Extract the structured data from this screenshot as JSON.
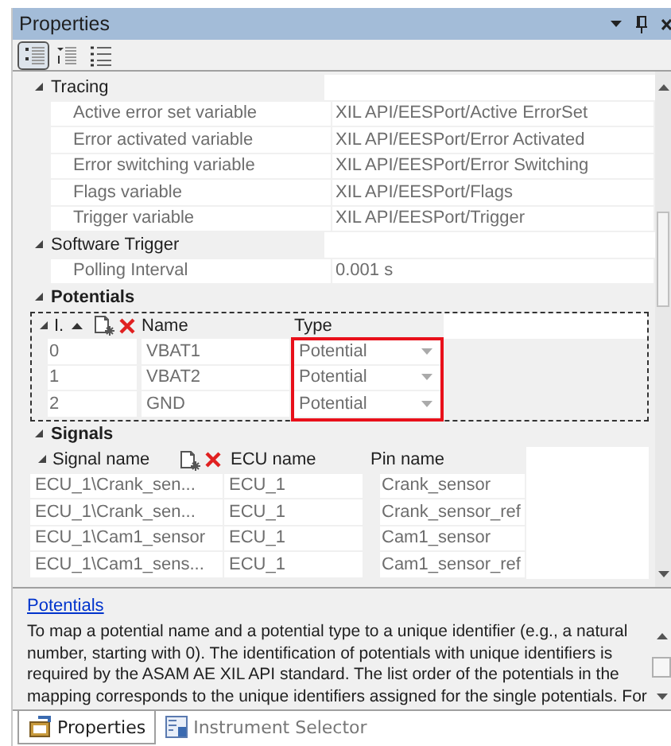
{
  "window": {
    "title": "Properties"
  },
  "toolbar": [
    {
      "kind": "categorized",
      "selected": true
    },
    {
      "kind": "alphabetical",
      "selected": false
    },
    {
      "kind": "pages",
      "selected": false
    }
  ],
  "categories": [
    {
      "name": "Tracing",
      "expanded": true,
      "properties": [
        {
          "name": "Active error set variable",
          "value": "XIL API/EESPort/Active ErrorSet"
        },
        {
          "name": "Error activated variable",
          "value": "XIL API/EESPort/Error Activated"
        },
        {
          "name": "Error switching variable",
          "value": "XIL API/EESPort/Error Switching"
        },
        {
          "name": "Flags variable",
          "value": "XIL API/EESPort/Flags"
        },
        {
          "name": "Trigger variable",
          "value": "XIL API/EESPort/Trigger"
        }
      ]
    },
    {
      "name": "Software Trigger",
      "expanded": true,
      "properties": [
        {
          "name": "Polling Interval",
          "value": "0.001 s"
        }
      ]
    }
  ],
  "potentials": {
    "name": "Potentials",
    "expanded": true,
    "columns": [
      {
        "label": "I.",
        "highlighted": false
      },
      {
        "label": "Name",
        "highlighted": false
      },
      {
        "label": "Type",
        "highlighted": true
      }
    ],
    "rows": [
      {
        "index": "0",
        "name": "VBAT1",
        "type": "Potential"
      },
      {
        "index": "1",
        "name": "VBAT2",
        "type": "Potential"
      },
      {
        "index": "2",
        "name": "GND",
        "type": "Potential"
      }
    ]
  },
  "signals": {
    "name": "Signals",
    "expanded": true,
    "columns": [
      {
        "label": "Signal name"
      },
      {
        "label": "ECU name"
      },
      {
        "label": "Pin name"
      }
    ],
    "rows": [
      [
        "ECU_1\\Crank_sen...",
        "ECU_1",
        "Crank_sensor"
      ],
      [
        "ECU_1\\Crank_sen...",
        "ECU_1",
        "Crank_sensor_ref"
      ],
      [
        "ECU_1\\Cam1_sensor",
        "ECU_1",
        "Cam1_sensor"
      ],
      [
        "ECU_1\\Cam1_sens...",
        "ECU_1",
        "Cam1_sensor_ref"
      ]
    ]
  },
  "description": {
    "title": "Potentials",
    "text": "To map a potential name and a potential type to a unique identifier (e.g., a natural number, starting with 0). The identification of potentials with unique identifiers is required by the ASAM AE XIL API standard. The list order of the potentials in the mapping corresponds to the unique identifiers assigned for the single potentials. For"
  },
  "tabs": [
    {
      "label": "Properties",
      "kind": "properties",
      "selected": true
    },
    {
      "label": "Instrument Selector",
      "kind": "instruments",
      "selected": false
    }
  ]
}
